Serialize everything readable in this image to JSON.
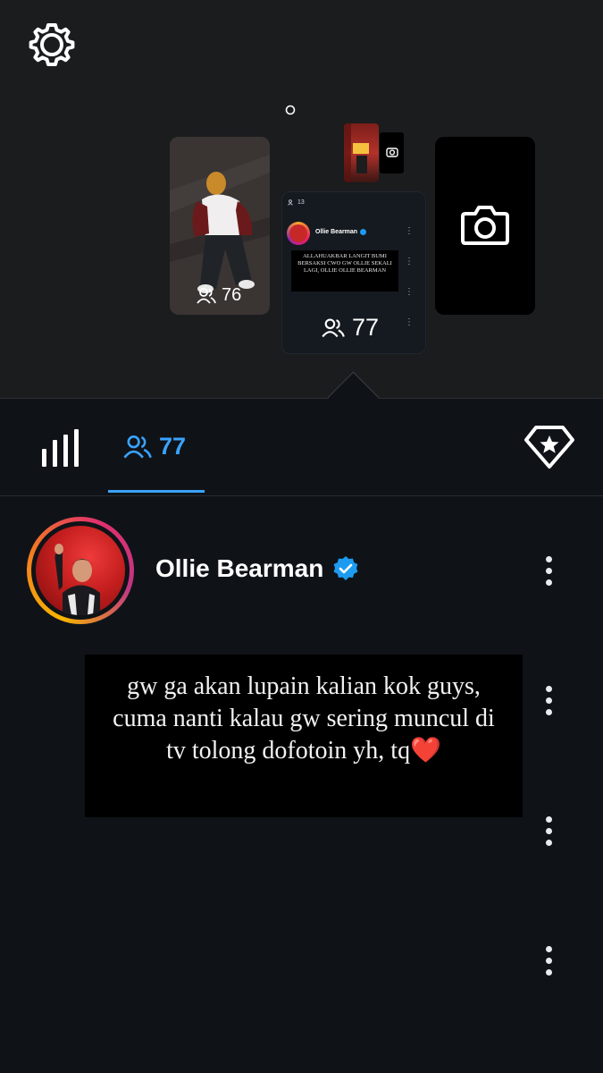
{
  "icons": {
    "settings": "gear-icon",
    "stats": "bar-chart-icon",
    "viewers": "people-icon",
    "boost": "diamond-star-icon",
    "camera": "camera-icon",
    "more": "more-vertical-icon"
  },
  "story_tray": {
    "left_thumb": {
      "viewer_count": "76"
    },
    "current": {
      "header_count": "13",
      "user_name": "Ollie Bearman",
      "caption": "ALLAHUAKBAR LANGIT BUMI BERSAKSI CWO GW OLLIE SEKALI LAGI, OLLIE OLLIE BEARMAN",
      "viewer_count": "77"
    }
  },
  "tabs": {
    "viewers_count": "77"
  },
  "viewer_row": {
    "name": "Ollie Bearman",
    "verified": true
  },
  "caption_box": {
    "text": "gw ga akan lupain kalian kok guys, cuma nanti kalau gw sering muncul di tv tolong dofotoin yh, tq❤️"
  },
  "colors": {
    "accent": "#3aa3ff",
    "verified": "#1d9bf0",
    "background": "#0f1318",
    "tray_background": "#1b1c1e"
  }
}
